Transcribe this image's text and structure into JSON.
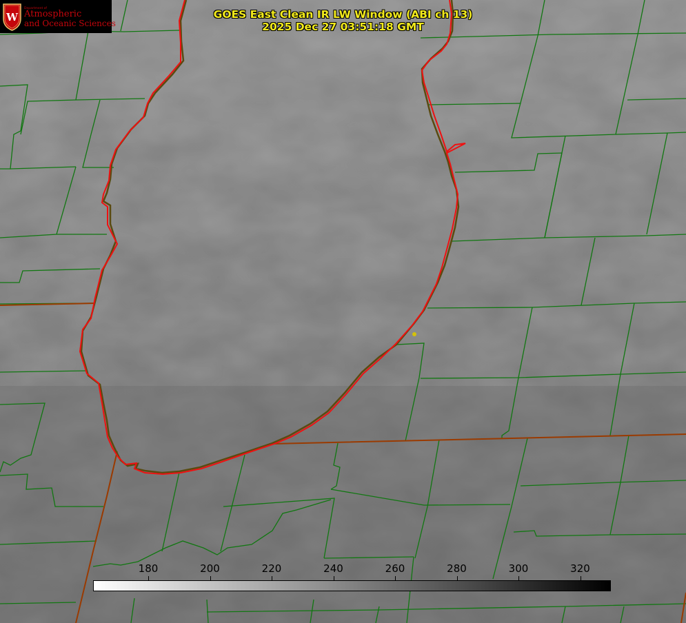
{
  "title_line1": "GOES East Clean IR LW Window (ABI ch 13)",
  "title_line2": "2025 Dec 27 03:51:18 GMT",
  "logo": {
    "dept": "Department of",
    "line1": "Atmospheric",
    "line2": "and Oceanic Sciences",
    "seal_letter": "W"
  },
  "colorbar": {
    "ticks": [
      "180",
      "200",
      "220",
      "240",
      "260",
      "280",
      "300",
      "320"
    ]
  },
  "colors": {
    "county_lines": "#117711",
    "shoreline": "#ee1111",
    "state_lines": "#aa3300",
    "title": "#f2ea1c",
    "marker": "#d4c20a"
  }
}
